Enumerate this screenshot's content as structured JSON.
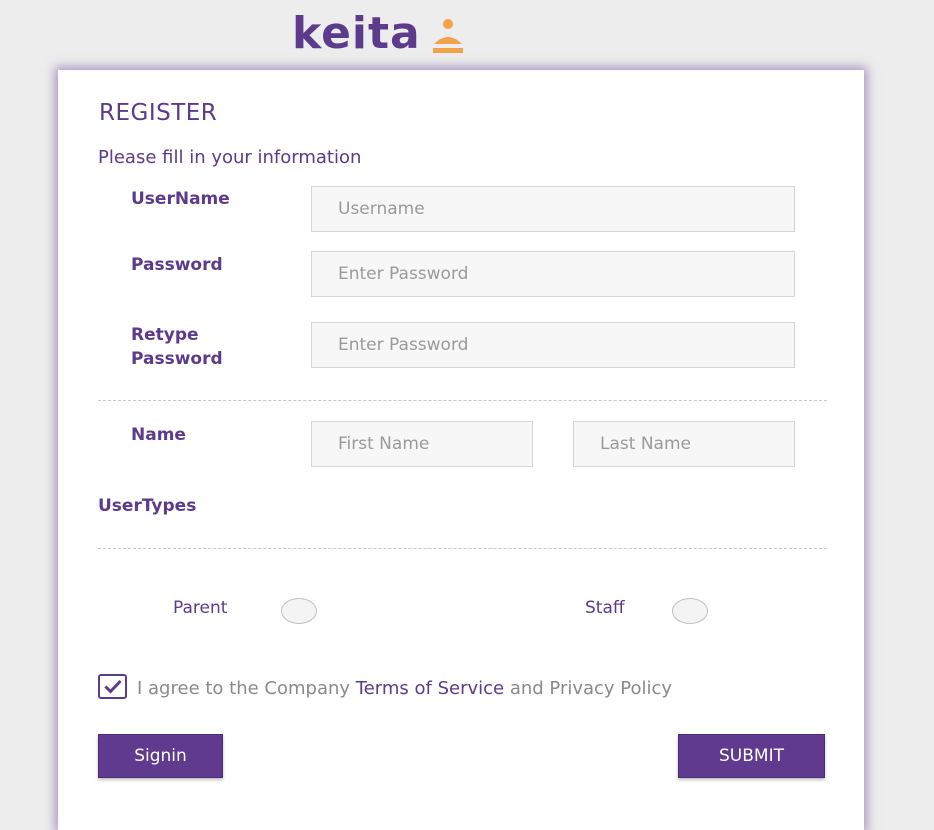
{
  "brand": {
    "logo_text": "keita",
    "logo_icon": "person-icon",
    "colors": {
      "primary": "#5c3a8c",
      "accent": "#f0a34a"
    }
  },
  "form": {
    "title": "REGISTER",
    "subtitle": "Please fill in your information",
    "username": {
      "label": "UserName",
      "placeholder": "Username",
      "value": ""
    },
    "password": {
      "label": "Password",
      "placeholder": "Enter Password",
      "value": ""
    },
    "retype_password": {
      "label_line1": "Retype",
      "label_line2": "Password",
      "placeholder": "Enter Password",
      "value": ""
    },
    "name": {
      "label": "Name",
      "first_placeholder": "First Name",
      "last_placeholder": "Last Name"
    },
    "user_types": {
      "label": "UserTypes",
      "options": [
        {
          "label": "Parent",
          "selected": false
        },
        {
          "label": "Staff",
          "selected": false
        }
      ]
    },
    "agreement": {
      "checked": true,
      "text_before": "I agree to the Company ",
      "link_text": "Terms of Service",
      "text_after": " and Privacy Policy"
    },
    "signin_label": "Signin",
    "submit_label": "SUBMIT"
  }
}
